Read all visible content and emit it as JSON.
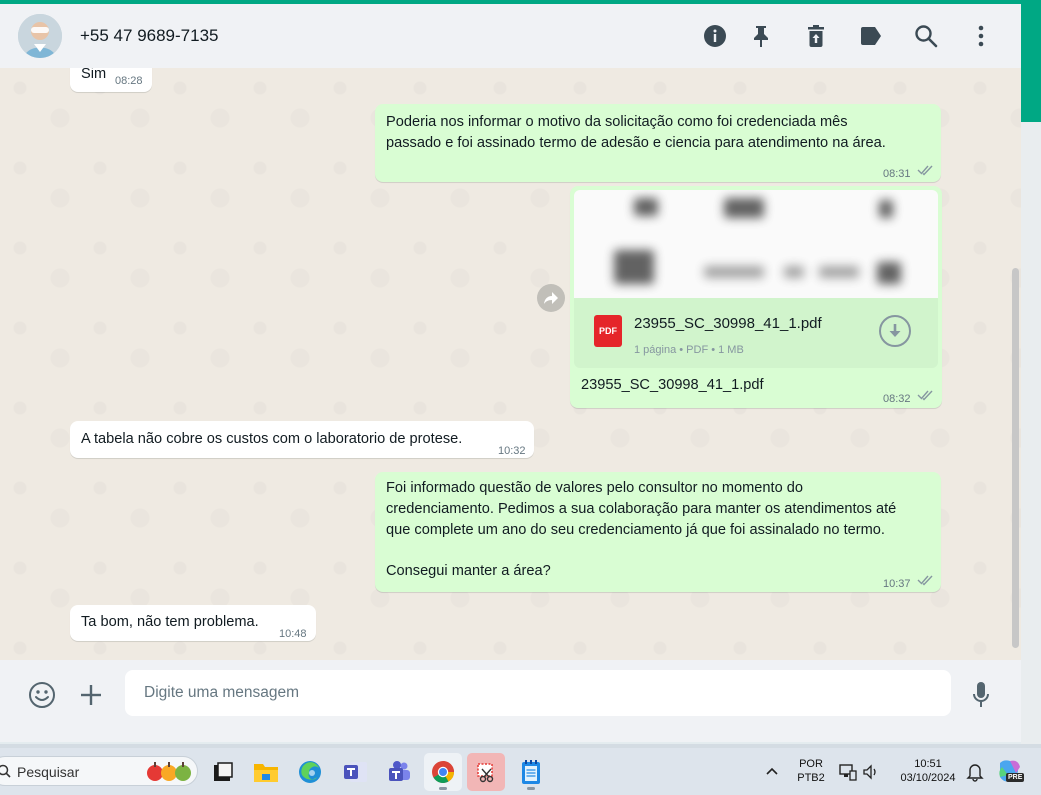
{
  "header": {
    "contact_name": "+55 47 9689-7135",
    "icons": [
      "info-icon",
      "pin-icon",
      "delete-icon",
      "label-icon",
      "search-icon",
      "menu-icon"
    ]
  },
  "messages": [
    {
      "direction": "in",
      "text": "Sim",
      "time": "08:28"
    },
    {
      "direction": "out",
      "lines": [
        "Poderia nos informar o motivo da solicitação como foi credenciada mês",
        "passado e foi assinado termo de adesão e ciencia para atendimento na área."
      ],
      "time": "08:31",
      "status": "read"
    },
    {
      "direction": "out",
      "type": "document",
      "file_name": "23955_SC_30998_41_1.pdf",
      "file_meta": "1 página • PDF • 1 MB",
      "caption": "23955_SC_30998_41_1.pdf",
      "time": "08:32",
      "status": "read"
    },
    {
      "direction": "in",
      "text": "A tabela não cobre os custos com o laboratorio de protese.",
      "time": "10:32"
    },
    {
      "direction": "out",
      "lines": [
        "Foi informado questão de valores pelo consultor no momento do",
        "credenciamento. Pedimos a sua colaboração para manter os atendimentos até",
        "que complete um ano do seu credenciamento já que foi assinalado no termo.",
        "",
        "Consegui manter a área?"
      ],
      "time": "10:37",
      "status": "read"
    },
    {
      "direction": "in",
      "text": "Ta bom, não tem problema.",
      "time": "10:48"
    }
  ],
  "composer": {
    "placeholder": "Digite uma mensagem"
  },
  "taskbar": {
    "search_label": "Pesquisar",
    "apps": [
      "file-explorer-icon",
      "folder-icon",
      "edge-icon",
      "teams-classic-icon",
      "teams-icon",
      "chrome-icon",
      "snipping-tool-icon",
      "notepad-icon"
    ],
    "lang_top": "POR",
    "lang_bottom": "PTB2",
    "clock_time": "10:51",
    "clock_date": "03/10/2024",
    "copilot_badge": "PRE"
  },
  "colors": {
    "accent": "#00a884",
    "outgoing": "#d9fdd3",
    "incoming": "#ffffff",
    "chat_bg": "#efeae2"
  }
}
